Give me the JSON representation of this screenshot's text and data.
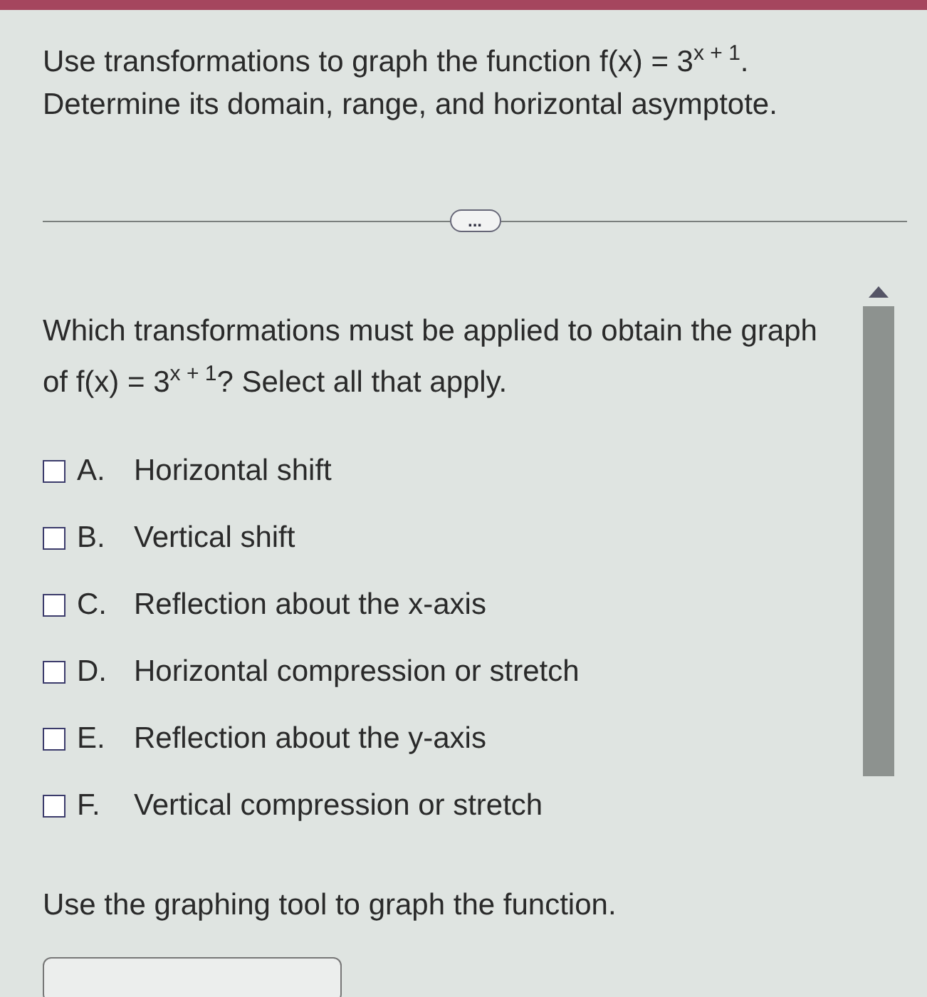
{
  "question": {
    "lines": [
      "Use transformations to graph the function f(x) = 3$^{x + 1}$.",
      "Determine its domain, range, and horizontal asymptote."
    ]
  },
  "more_button": {
    "label": "..."
  },
  "prompt": "Which transformations must be applied to obtain the graph of f(x) = 3$^{x + 1}$? Select all that apply.",
  "options": [
    {
      "letter": "A.",
      "text": "Horizontal shift",
      "checked": false
    },
    {
      "letter": "B.",
      "text": "Vertical shift",
      "checked": false
    },
    {
      "letter": "C.",
      "text": "Reflection about the x-axis",
      "checked": false
    },
    {
      "letter": "D.",
      "text": "Horizontal compression or stretch",
      "checked": false
    },
    {
      "letter": "E.",
      "text": "Reflection about the y-axis",
      "checked": false
    },
    {
      "letter": "F.",
      "text": "Vertical compression or stretch",
      "checked": false
    }
  ],
  "instruction": "Use the graphing tool to graph the function."
}
